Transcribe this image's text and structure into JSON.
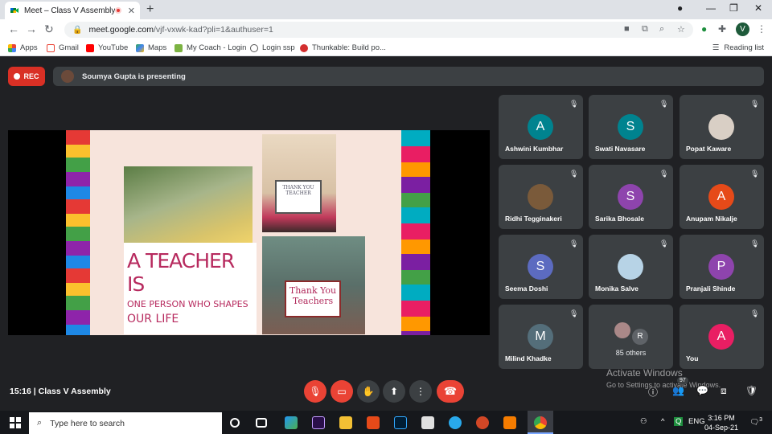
{
  "browser": {
    "tab_title": "Meet – Class V Assembly",
    "url_host": "meet.google.com",
    "url_path": "/vjf-vxwk-kad?pli=1&authuser=1",
    "profile_initial": "V",
    "bookmarks": [
      "Apps",
      "Gmail",
      "YouTube",
      "Maps",
      "My Coach - Login",
      "Login ssp",
      "Thunkable: Build po..."
    ],
    "reading_list": "Reading list"
  },
  "meet": {
    "rec_label": "REC",
    "presenting_text": "Soumya Gupta is presenting",
    "slide": {
      "banner_line1": "A TEACHER IS",
      "banner_line2": "ONE PERSON WHO SHAPES",
      "banner_line3": "OUR LIFE",
      "card_small_1": "THANK YOU",
      "card_small_2": "TEACHER",
      "card_large_1": "Thank You",
      "card_large_2": "Teachers"
    },
    "participants": [
      {
        "name": "Ashwini Kumbhar",
        "initial": "A",
        "color": "#00838f"
      },
      {
        "name": "Swati Navasare",
        "initial": "S",
        "color": "#00838f"
      },
      {
        "name": "Popat Kaware",
        "initial": "",
        "color": "#d9cfc5"
      },
      {
        "name": "Ridhi Tegginakeri",
        "initial": "",
        "color": "#7a5a3a"
      },
      {
        "name": "Sarika Bhosale",
        "initial": "S",
        "color": "#8e44ad"
      },
      {
        "name": "Anupam Nikalje",
        "initial": "A",
        "color": "#e64a19"
      },
      {
        "name": "Seema Doshi",
        "initial": "S",
        "color": "#5c6bc0"
      },
      {
        "name": "Monika Salve",
        "initial": "",
        "color": "#b7d3e6"
      },
      {
        "name": "Pranjali Shinde",
        "initial": "P",
        "color": "#8e44ad"
      },
      {
        "name": "Milind Khadke",
        "initial": "M",
        "color": "#546e7a"
      },
      {
        "name": "85 others",
        "initial": "R",
        "color": "#5f6368"
      },
      {
        "name": "You",
        "initial": "A",
        "color": "#e91e63"
      }
    ],
    "time": "15:16",
    "meeting_name": "Class V Assembly",
    "people_count": "97",
    "watermark_title": "Activate Windows",
    "watermark_sub": "Go to Settings to activate Windows."
  },
  "taskbar": {
    "search_placeholder": "Type here to search",
    "lang": "ENG",
    "time": "3:16 PM",
    "date": "04-Sep-21",
    "notif_count": "3"
  }
}
